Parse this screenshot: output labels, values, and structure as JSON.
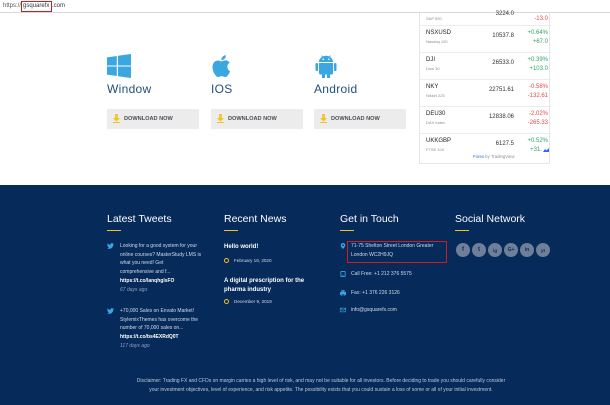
{
  "url": {
    "scheme": "https://",
    "host": "gsquarefx",
    "tld": ".com"
  },
  "downloads": {
    "platforms": [
      {
        "name": "Window",
        "icon": "windows-icon",
        "button": "DOWNLOAD NOW"
      },
      {
        "name": "IOS",
        "icon": "apple-icon",
        "button": "DOWNLOAD NOW"
      },
      {
        "name": "Android",
        "icon": "android-icon",
        "button": "DOWNLOAD NOW"
      }
    ]
  },
  "ticker": {
    "rows": [
      {
        "symbol": "",
        "desc": "S&P 500",
        "price": "3224.0",
        "pct": "",
        "chg": "-13.0",
        "dir": "down"
      },
      {
        "symbol": "NSXUSD",
        "desc": "Nasdaq 100",
        "price": "10537.8",
        "pct": "+0.64%",
        "chg": "+67.0",
        "dir": "up"
      },
      {
        "symbol": "DJI",
        "desc": "Dow 30",
        "price": "26533.0",
        "pct": "+0.39%",
        "chg": "+103.0",
        "dir": "up"
      },
      {
        "symbol": "NKY",
        "desc": "Nikkei 225",
        "price": "22751.61",
        "pct": "-0.58%",
        "chg": "-132.61",
        "dir": "down"
      },
      {
        "symbol": "DEU30",
        "desc": "DAX Index",
        "price": "12838.06",
        "pct": "-2.02%",
        "chg": "-265.33",
        "dir": "down"
      },
      {
        "symbol": "UKKGBP",
        "desc": "FTSE 100",
        "price": "6127.5",
        "pct": "+0.52%",
        "chg": "+31.",
        "dir": "up"
      }
    ],
    "credit_link": "Forex",
    "credit_text": " by TradingView"
  },
  "footer": {
    "tweets_heading": "Latest Tweets",
    "news_heading": "Recent News",
    "contact_heading": "Get in Touch",
    "social_heading": "Social Network",
    "tweets": [
      {
        "lines": [
          "Looking for a good system for your",
          "online courses? MasterStudy LMS is",
          "what you need!    Get",
          "comprehensive and f..."
        ],
        "link": "https://t.co/lanqhgIsFO",
        "time": "67 days ago"
      },
      {
        "lines": [
          "+70,000 Sales on Envato Market!",
          "StylemixThemes has overcome the",
          "number of 70,000 sales on..."
        ],
        "link": "https://t.co/bs4EXRdQ0T",
        "time": "117 days ago"
      }
    ],
    "news": [
      {
        "title": "Hello world!",
        "date": "February 18, 2020"
      },
      {
        "title": "A digital prescription for the pharma industry",
        "date": "December 9, 2019"
      }
    ],
    "contact": {
      "address_line1": "71-75 Shelton Street London Greater",
      "address_line2": "London WC2H9JQ",
      "call": "Call Free: +1 212 376 5575",
      "fax": "Fax: +1 376 226 3126",
      "email": "info@gsquarefx.com"
    },
    "social": [
      "f",
      "t",
      "ig",
      "G+",
      "in",
      "yt"
    ],
    "disclaimer_line1": "Disclaimer: Trading FX and CFDs on margin carries a high level of risk, and may not be suitable for all investors. Before deciding to trade you should carefully consider",
    "disclaimer_line2": "your investment objectives, level of experience, and risk appetite. The possibility exists that you could sustain a loss of some or all of your initial investment."
  },
  "colors": {
    "footer_bg": "#062a5a",
    "accent": "#f4c21d",
    "up": "#2aa661",
    "down": "#e24a4a",
    "highlight": "#d01c1c"
  }
}
